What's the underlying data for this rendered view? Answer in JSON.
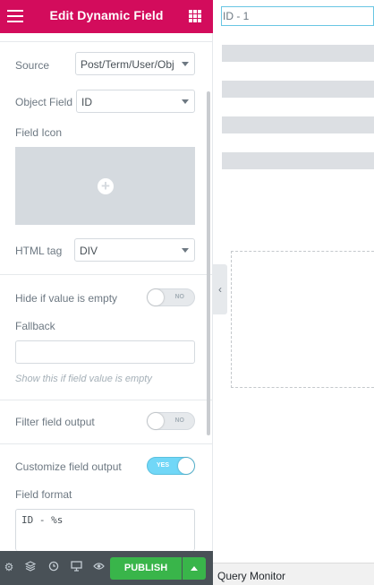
{
  "header": {
    "title": "Edit Dynamic Field"
  },
  "fields": {
    "source": {
      "label": "Source",
      "value": "Post/Term/User/Obj"
    },
    "object_field": {
      "label": "Object Field",
      "value": "ID"
    },
    "field_icon": {
      "label": "Field Icon"
    },
    "html_tag": {
      "label": "HTML tag",
      "value": "DIV"
    },
    "hide_if_empty": {
      "label": "Hide if value is empty",
      "toggle": "NO"
    },
    "fallback": {
      "label": "Fallback",
      "value": "",
      "hint": "Show this if field value is empty"
    },
    "filter_output": {
      "label": "Filter field output",
      "toggle": "NO"
    },
    "customize_output": {
      "label": "Customize field output",
      "toggle": "YES"
    },
    "field_format": {
      "label": "Field format",
      "value": "ID - %s"
    }
  },
  "footer": {
    "publish_label": "PUBLISH"
  },
  "preview": {
    "id_text": "ID - 1",
    "query_monitor": "Query Monitor"
  },
  "colors": {
    "brand": "#d30c5c",
    "publish": "#39b54a",
    "footer": "#495157",
    "toggle_on": "#71d7f7"
  }
}
